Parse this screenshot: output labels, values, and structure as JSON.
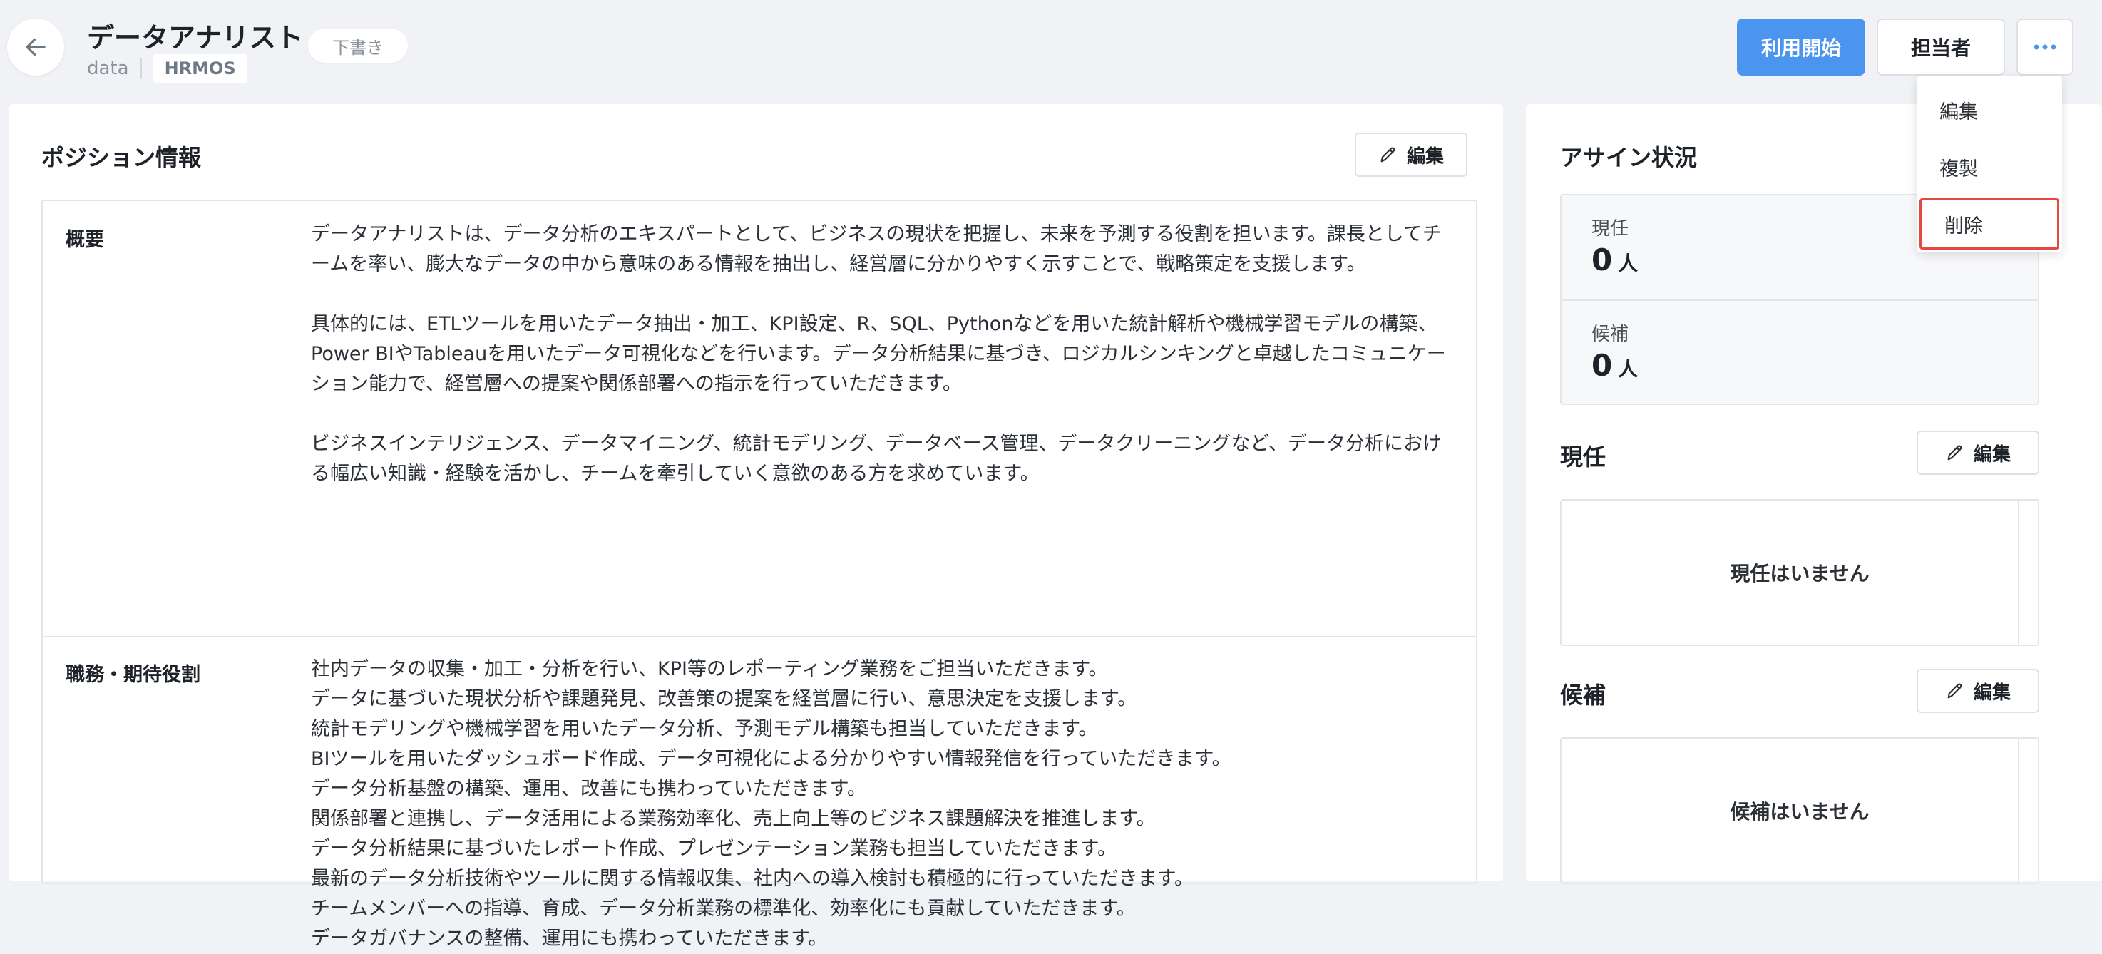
{
  "header": {
    "title": "データアナリスト",
    "status": "下書き",
    "meta_text": "data",
    "tag": "HRMOS",
    "primary_button": "利用開始",
    "assignee_button": "担当者",
    "more_icon": "more-horizontal-icon",
    "back_icon": "arrow-left-icon"
  },
  "dropdown": {
    "items": [
      {
        "label": "編集"
      },
      {
        "label": "複製"
      },
      {
        "label": "削除"
      }
    ]
  },
  "position": {
    "title": "ポジション情報",
    "edit_label": "編集",
    "summary_label": "概要",
    "summary_paragraphs": [
      "データアナリストは、データ分析のエキスパートとして、ビジネスの現状を把握し、未来を予測する役割を担います。課長としてチームを率い、膨大なデータの中から意味のある情報を抽出し、経営層に分かりやすく示すことで、戦略策定を支援します。",
      "具体的には、ETLツールを用いたデータ抽出・加工、KPI設定、R、SQL、Pythonなどを用いた統計解析や機械学習モデルの構築、Power BIやTableauを用いたデータ可視化などを行います。データ分析結果に基づき、ロジカルシンキングと卓越したコミュニケーション能力で、経営層への提案や関係部署への指示を行っていただきます。",
      "ビジネスインテリジェンス、データマイニング、統計モデリング、データベース管理、データクリーニングなど、データ分析における幅広い知識・経験を活かし、チームを牽引していく意欲のある方を求めています。"
    ],
    "duties_label": "職務・期待役割",
    "duties": [
      "社内データの収集・加工・分析を行い、KPI等のレポーティング業務をご担当いただきます。",
      "データに基づいた現状分析や課題発見、改善策の提案を経営層に行い、意思決定を支援します。",
      "統計モデリングや機械学習を用いたデータ分析、予測モデル構築も担当していただきます。",
      "BIツールを用いたダッシュボード作成、データ可視化による分かりやすい情報発信を行っていただきます。",
      "データ分析基盤の構築、運用、改善にも携わっていただきます。",
      "関係部署と連携し、データ活用による業務効率化、売上向上等のビジネス課題解決を推進します。",
      "データ分析結果に基づいたレポート作成、プレゼンテーション業務も担当していただきます。",
      "最新のデータ分析技術やツールに関する情報収集、社内への導入検討も積極的に行っていただきます。",
      "チームメンバーへの指導、育成、データ分析業務の標準化、効率化にも貢献していただきます。",
      "データガバナンスの整備、運用にも携わっていただきます。"
    ]
  },
  "assignment": {
    "title": "アサイン状況",
    "current_label": "現任",
    "current_count": "0",
    "candidate_label": "候補",
    "candidate_count": "0",
    "unit": "人",
    "current_section_title": "現任",
    "current_edit_label": "編集",
    "current_empty": "現任はいません",
    "candidate_section_title": "候補",
    "candidate_edit_label": "編集",
    "candidate_empty": "候補はいません"
  },
  "colors": {
    "primary": "#4b95ef",
    "highlight_border": "#e5483d",
    "background": "#f0f2f5"
  }
}
